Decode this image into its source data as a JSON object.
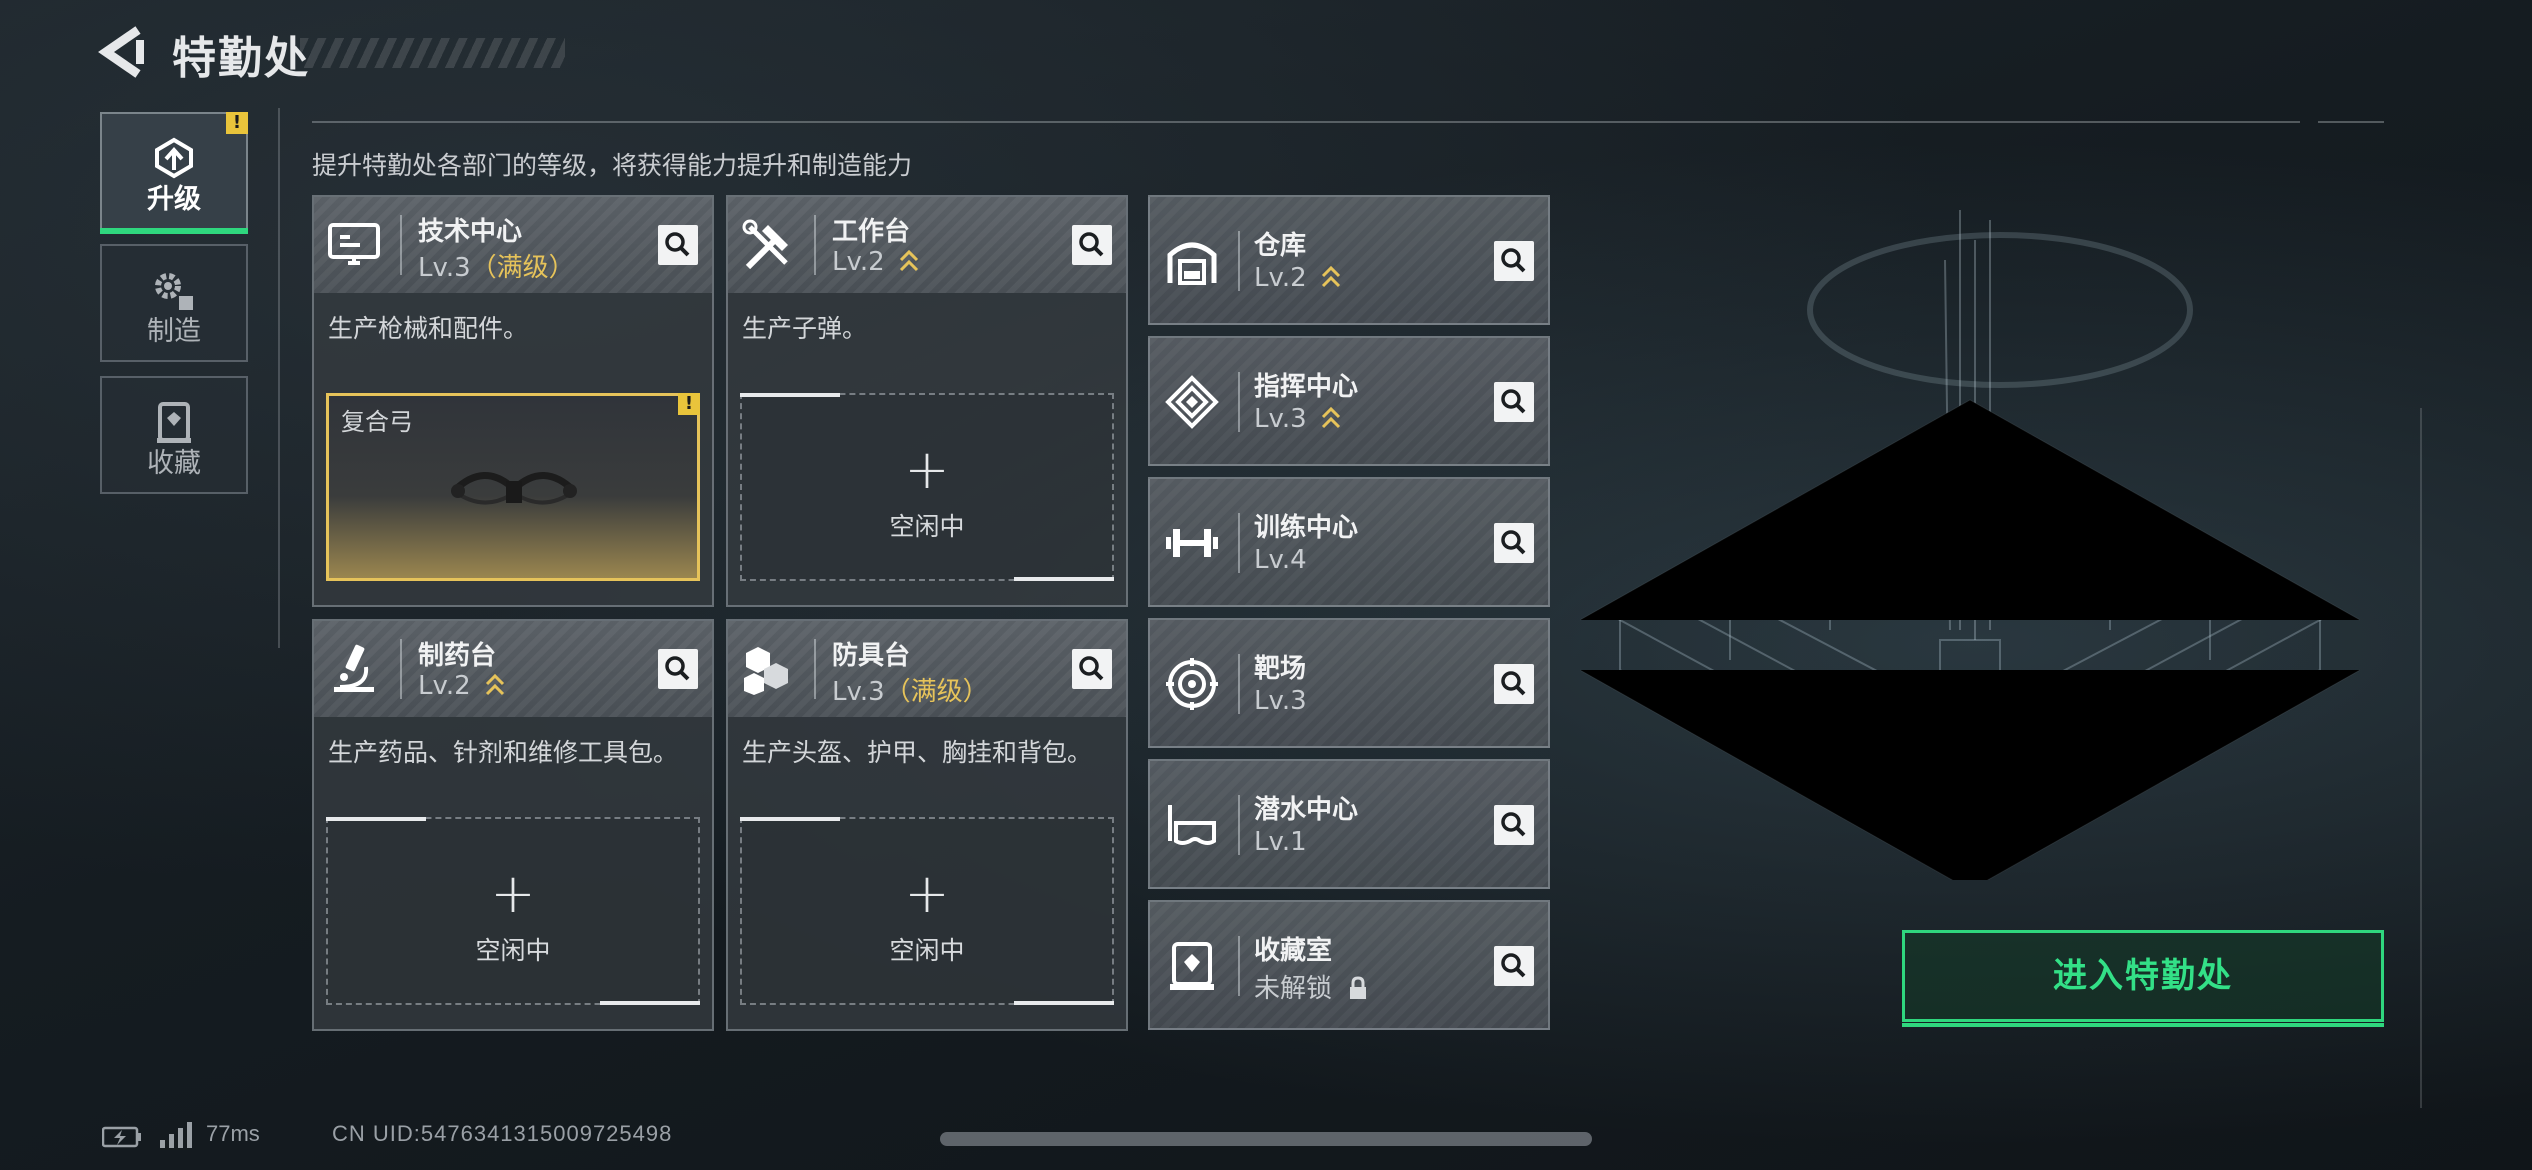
{
  "header": {
    "title": "特勤处",
    "back_icon": "back-arrow-icon"
  },
  "subtitle": "提升特勤处各部门的等级，将获得能力提升和制造能力",
  "tabs": [
    {
      "label": "升级",
      "icon": "upgrade-icon",
      "active": true,
      "alert": "!"
    },
    {
      "label": "制造",
      "icon": "gears-icon",
      "active": false
    },
    {
      "label": "收藏",
      "icon": "collection-icon",
      "active": false
    }
  ],
  "workshops": [
    {
      "name": "技术中心",
      "level": "Lv.3",
      "max_tag": "（满级）",
      "icon": "monitor-icon",
      "desc": "生产枪械和配件。",
      "slot": {
        "state": "busy",
        "item": "复合弓",
        "alert": "!"
      }
    },
    {
      "name": "工作台",
      "level": "Lv.2",
      "icon": "tools-icon",
      "upgradeable": true,
      "desc": "生产子弹。",
      "slot": {
        "state": "idle",
        "plus": "+",
        "label": "空闲中"
      }
    },
    {
      "name": "制药台",
      "level": "Lv.2",
      "icon": "microscope-icon",
      "upgradeable": true,
      "desc": "生产药品、针剂和维修工具包。",
      "slot": {
        "state": "idle",
        "plus": "+",
        "label": "空闲中"
      }
    },
    {
      "name": "防具台",
      "level": "Lv.3",
      "max_tag": "（满级）",
      "icon": "cubes-icon",
      "desc": "生产头盔、护甲、胸挂和背包。",
      "slot": {
        "state": "idle",
        "plus": "+",
        "label": "空闲中"
      }
    }
  ],
  "facilities": [
    {
      "name": "仓库",
      "level": "Lv.2",
      "icon": "warehouse-icon",
      "upgradeable": true
    },
    {
      "name": "指挥中心",
      "level": "Lv.3",
      "icon": "command-icon",
      "upgradeable": true
    },
    {
      "name": "训练中心",
      "level": "Lv.4",
      "icon": "dumbbell-icon"
    },
    {
      "name": "靶场",
      "level": "Lv.3",
      "icon": "target-icon"
    },
    {
      "name": "潜水中心",
      "level": "Lv.1",
      "icon": "diving-mask-icon"
    },
    {
      "name": "收藏室",
      "level": "未解锁",
      "icon": "display-case-icon",
      "locked": true
    }
  ],
  "enter_button": "进入特勤处",
  "status_bar": {
    "ping": "77ms",
    "uid": "CN UID:5476341315009725498"
  },
  "colors": {
    "accent_green": "#2fd77e",
    "max_gold": "#e6c35a",
    "alert_yellow": "#e9c43b"
  }
}
